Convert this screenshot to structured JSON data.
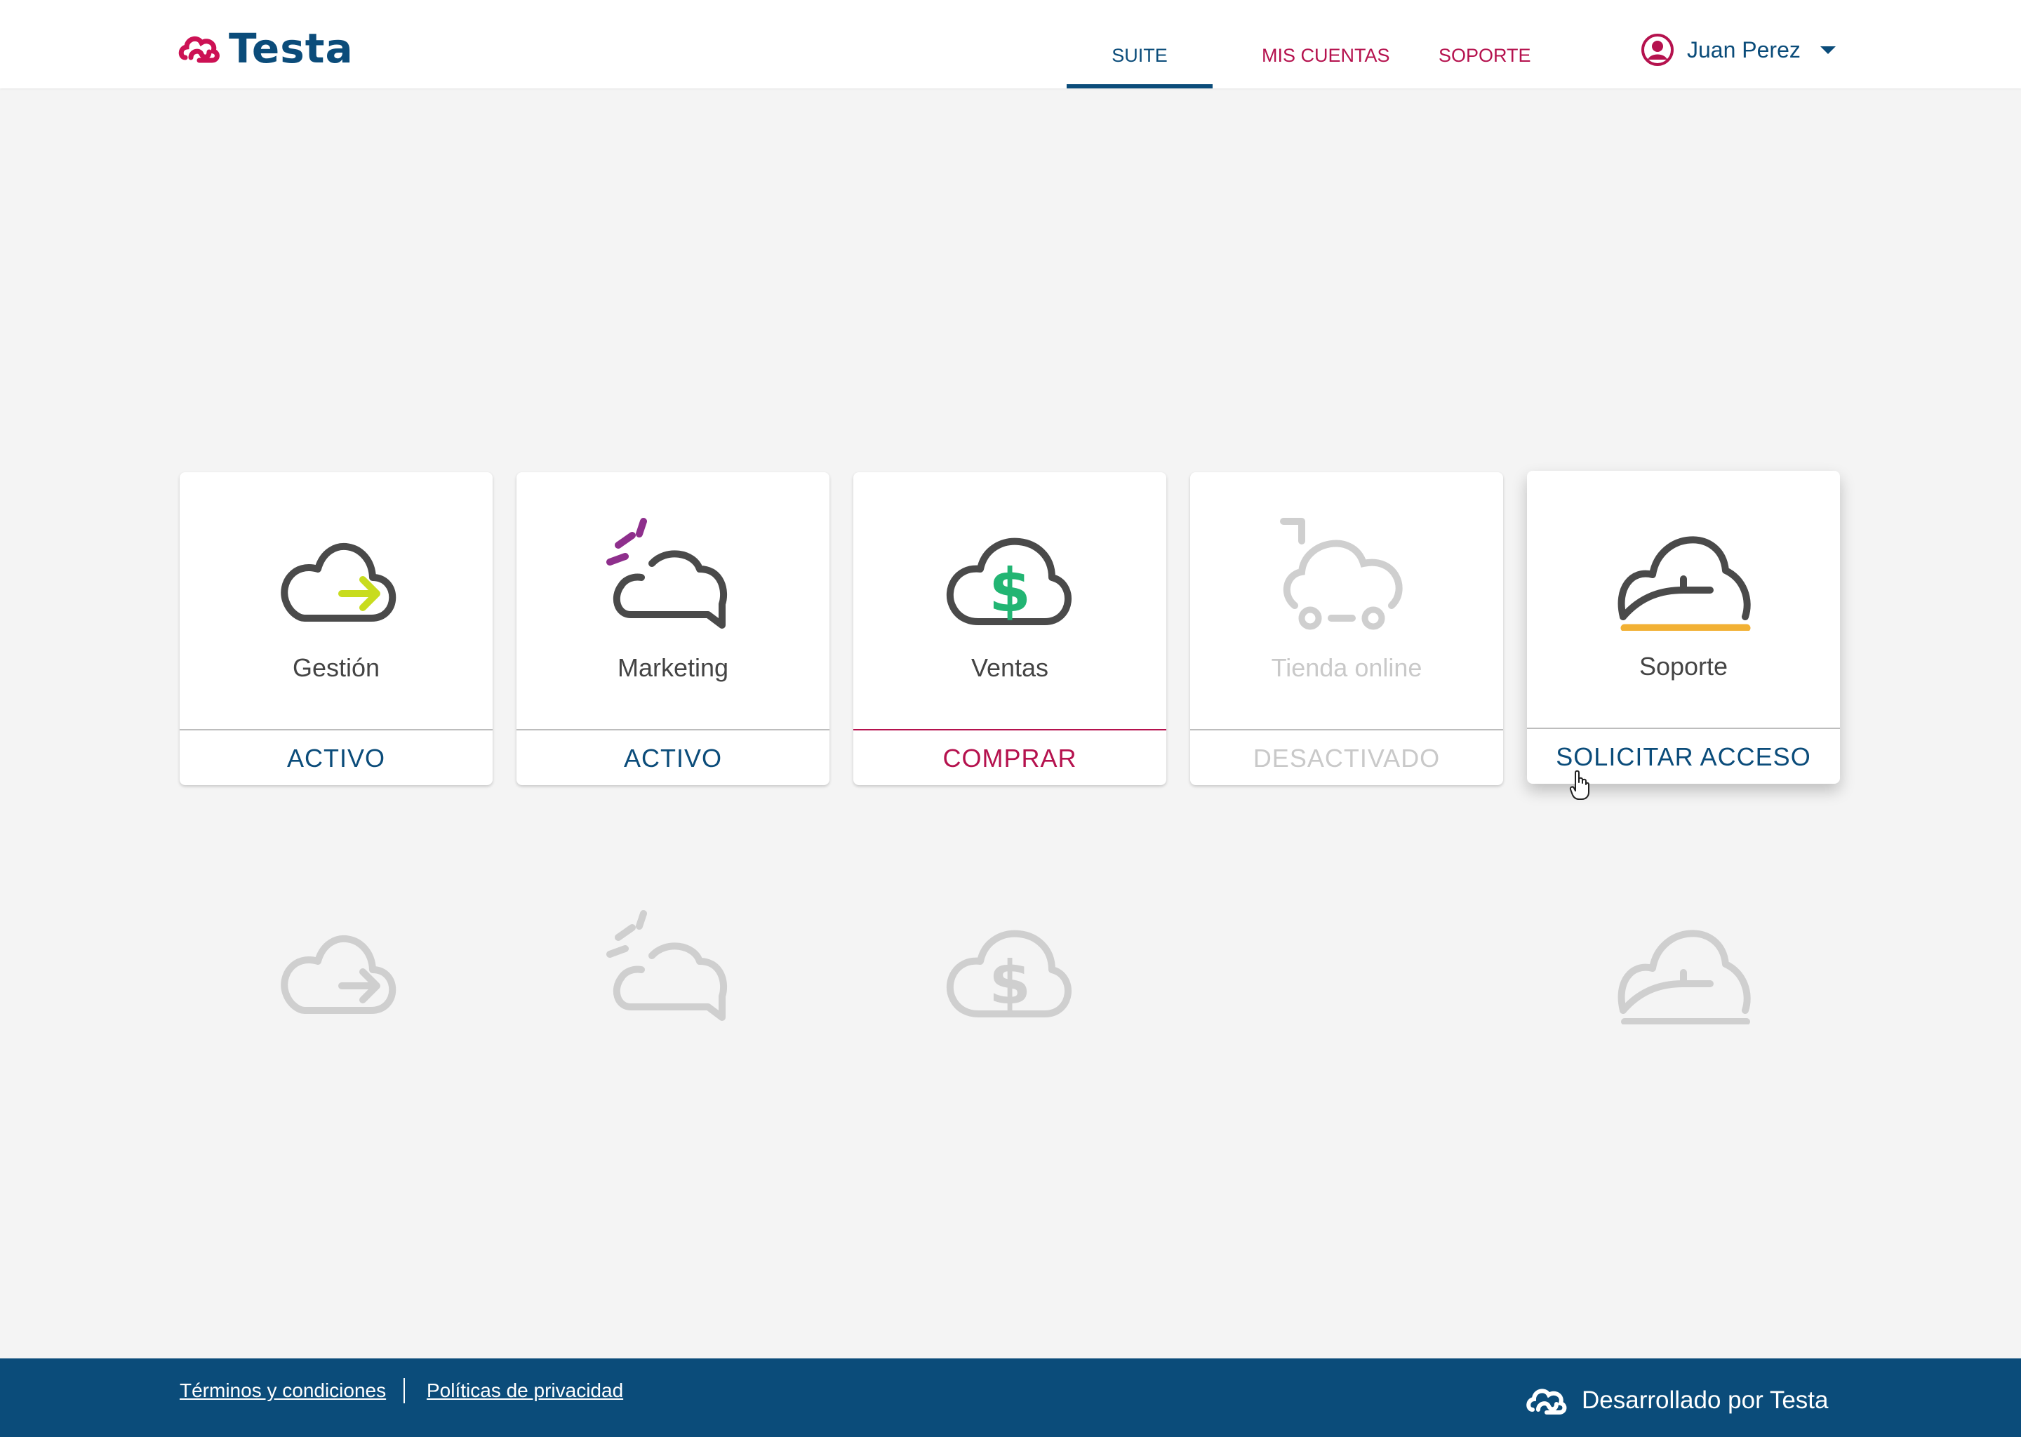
{
  "header": {
    "logo_text": "Testa",
    "nav": [
      {
        "label": "SUITE",
        "active": true
      },
      {
        "label": "MIS CUENTAS",
        "active": false
      },
      {
        "label": "SOPORTE",
        "active": false
      }
    ],
    "user_name": "Juan Perez"
  },
  "modules": [
    {
      "name": "Gestión",
      "status": "ACTIVO",
      "icon": "cloud-arrow-icon"
    },
    {
      "name": "Marketing",
      "status": "ACTIVO",
      "icon": "chat-cloud-icon"
    },
    {
      "name": "Ventas",
      "status": "COMPRAR",
      "icon": "cloud-dollar-icon"
    },
    {
      "name": "Tienda online",
      "status": "DESACTIVADO",
      "icon": "cloud-cart-icon"
    },
    {
      "name": "Soporte",
      "status": "SOLICITAR ACCESO",
      "icon": "cloud-support-icon"
    }
  ],
  "footer": {
    "terms": "Términos y condiciones",
    "privacy": "Políticas de privacidad",
    "developed_by": "Desarrollado por Testa"
  },
  "colors": {
    "brand_blue": "#0b4c7a",
    "brand_magenta": "#b5124e",
    "background": "#f4f4f4",
    "icon_dark": "#4a4a4a",
    "disabled_gray": "#c9c9c9",
    "accent_lime": "#c8dc1e",
    "accent_purple": "#8e2f8c",
    "accent_green": "#22b573",
    "accent_orange": "#f2b134"
  }
}
